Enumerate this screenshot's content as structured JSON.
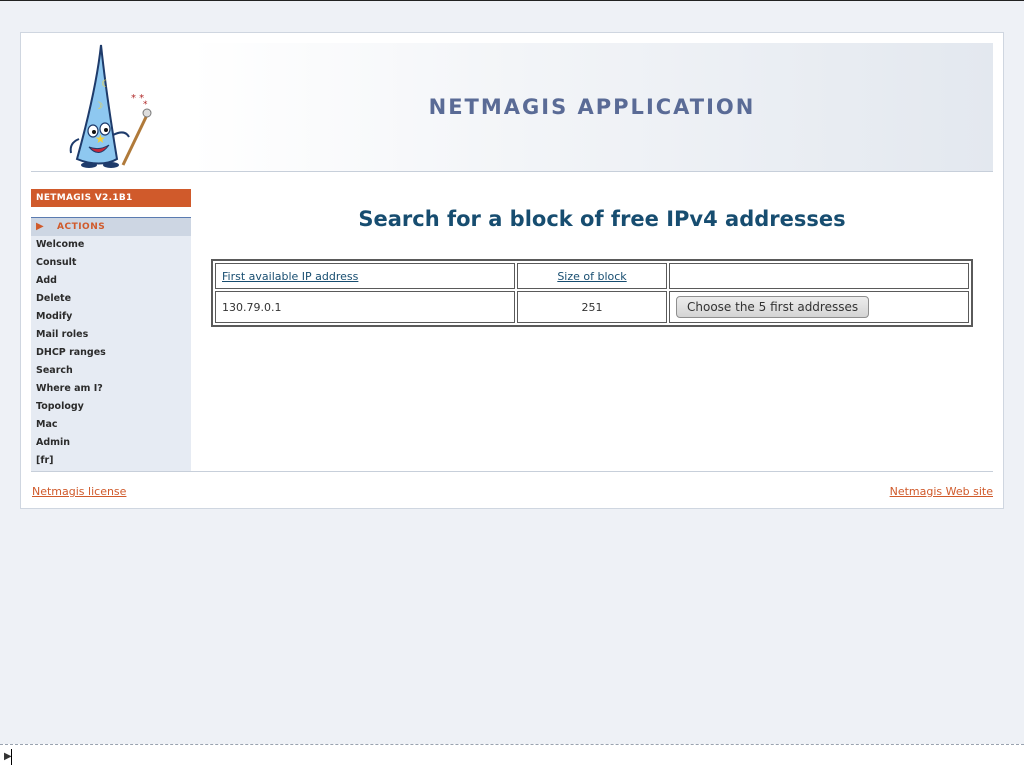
{
  "header": {
    "app_title": "NETMAGIS APPLICATION"
  },
  "sidebar": {
    "version": "NETMAGIS V2.1B1",
    "actions_label": "ACTIONS",
    "items": [
      {
        "label": "Welcome"
      },
      {
        "label": "Consult"
      },
      {
        "label": "Add"
      },
      {
        "label": "Delete"
      },
      {
        "label": "Modify"
      },
      {
        "label": "Mail roles"
      },
      {
        "label": "DHCP ranges"
      },
      {
        "label": "Search"
      },
      {
        "label": "Where am I?"
      },
      {
        "label": "Topology"
      },
      {
        "label": "Mac"
      },
      {
        "label": "Admin"
      },
      {
        "label": "[fr]"
      }
    ]
  },
  "main": {
    "title": "Search for a block of free IPv4 addresses",
    "table": {
      "headers": [
        "First available IP address",
        "Size of block",
        ""
      ],
      "rows": [
        {
          "first_ip": "130.79.0.1",
          "size": "251",
          "button_label": "Choose the 5 first addresses"
        }
      ]
    }
  },
  "footer": {
    "license_link": "Netmagis license",
    "website_link": "Netmagis Web site"
  },
  "colors": {
    "accent_orange": "#d05a2b",
    "title_blue": "#174d70",
    "banner_text": "#5a6b96",
    "sidebar_bg": "#e6ebf3"
  }
}
